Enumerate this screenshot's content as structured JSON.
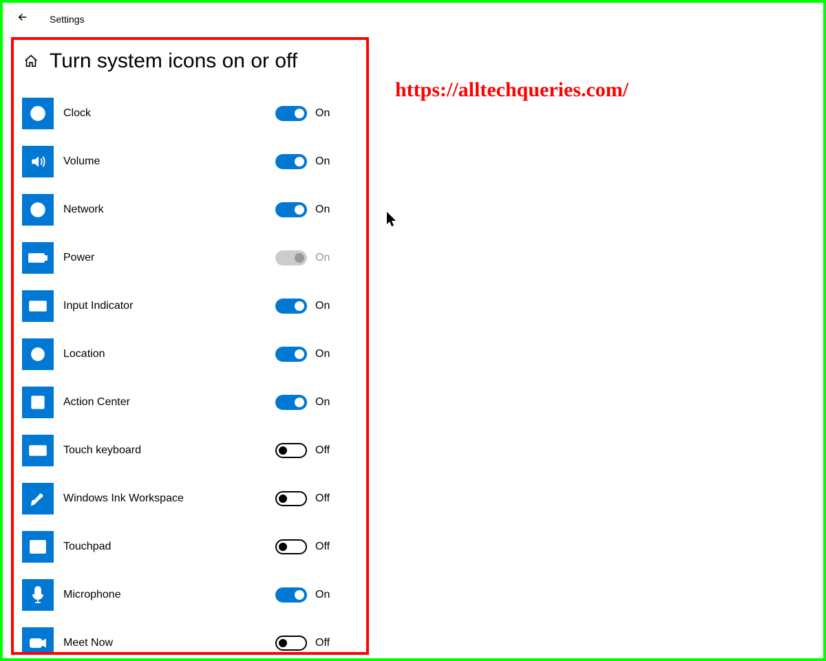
{
  "header": {
    "settings_label": "Settings"
  },
  "page_title": "Turn system icons on or off",
  "watermark": "https://alltechqueries.com/",
  "state_labels": {
    "on": "On",
    "off": "Off"
  },
  "items": [
    {
      "id": "clock",
      "label": "Clock",
      "on": true,
      "disabled": false,
      "icon": "clock-icon"
    },
    {
      "id": "volume",
      "label": "Volume",
      "on": true,
      "disabled": false,
      "icon": "volume-icon"
    },
    {
      "id": "network",
      "label": "Network",
      "on": true,
      "disabled": false,
      "icon": "network-icon"
    },
    {
      "id": "power",
      "label": "Power",
      "on": true,
      "disabled": true,
      "icon": "power-icon"
    },
    {
      "id": "input-indicator",
      "label": "Input Indicator",
      "on": true,
      "disabled": false,
      "icon": "keyboard-icon"
    },
    {
      "id": "location",
      "label": "Location",
      "on": true,
      "disabled": false,
      "icon": "location-icon"
    },
    {
      "id": "action-center",
      "label": "Action Center",
      "on": true,
      "disabled": false,
      "icon": "notification-icon"
    },
    {
      "id": "touch-keyboard",
      "label": "Touch keyboard",
      "on": false,
      "disabled": false,
      "icon": "touch-keyboard-icon"
    },
    {
      "id": "windows-ink",
      "label": "Windows Ink Workspace",
      "on": false,
      "disabled": false,
      "icon": "pen-icon"
    },
    {
      "id": "touchpad",
      "label": "Touchpad",
      "on": false,
      "disabled": false,
      "icon": "touchpad-icon"
    },
    {
      "id": "microphone",
      "label": "Microphone",
      "on": true,
      "disabled": false,
      "icon": "microphone-icon"
    },
    {
      "id": "meet-now",
      "label": "Meet Now",
      "on": false,
      "disabled": false,
      "icon": "camera-icon"
    }
  ]
}
